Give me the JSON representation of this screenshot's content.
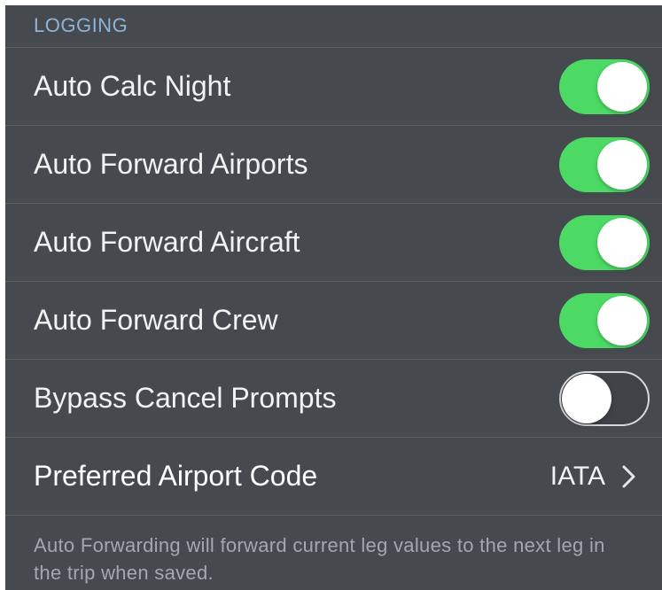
{
  "section": {
    "header": "LOGGING"
  },
  "settings": [
    {
      "label": "Auto Calc Night",
      "toggle_state": "on"
    },
    {
      "label": "Auto Forward Airports",
      "toggle_state": "on"
    },
    {
      "label": "Auto Forward Aircraft",
      "toggle_state": "on"
    },
    {
      "label": "Auto Forward Crew",
      "toggle_state": "on"
    },
    {
      "label": "Bypass Cancel Prompts",
      "toggle_state": "off"
    }
  ],
  "preferred_airport_code": {
    "label": "Preferred Airport Code",
    "value": "IATA",
    "icon": "chevron-right-icon"
  },
  "footer": {
    "note": "Auto Forwarding will forward current leg values to the next leg in the trip when saved."
  },
  "colors": {
    "background": "#464a4f",
    "header_text": "#8fb3d6",
    "toggle_on": "#4cd964",
    "separator": "#5c6066"
  }
}
